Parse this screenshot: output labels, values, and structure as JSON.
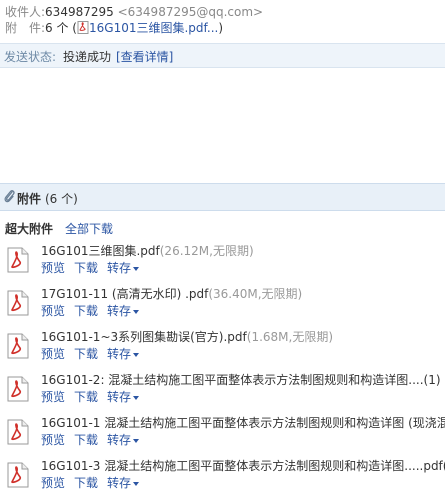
{
  "header": {
    "recipient_label": "收件人:",
    "recipient_name": "634987295",
    "recipient_email": "<634987295@qq.com>",
    "attachment_label": "附　件:",
    "attachment_count": "6 个 (",
    "attachment_first": "16G101三维图集.pdf...",
    "attachment_close": ")"
  },
  "status": {
    "label": "发送状态:",
    "value": "投递成功",
    "detail_link": "[查看详情]"
  },
  "attachments_section": {
    "title": "附件",
    "count": "(6 个)",
    "big_attach_title": "超大附件",
    "download_all": "全部下载"
  },
  "actions": {
    "preview": "预览",
    "download": "下载",
    "forward": "转存"
  },
  "files": [
    {
      "name": "16G101三维图集.pdf",
      "meta": "(26.12M,无限期)"
    },
    {
      "name": "17G101-11 (高清无水印) .pdf",
      "meta": "(36.40M,无限期)"
    },
    {
      "name": "16G101-1~3系列图集勘误(官方).pdf",
      "meta": "(1.68M,无限期)"
    },
    {
      "name": "16G101-2: 混凝土结构施工图平面整体表示方法制图规则和构造详图....(1)",
      "meta": ""
    },
    {
      "name": "16G101-1 混凝土结构施工图平面整体表示方法制图规则和构造详图 (现浇混",
      "meta": ""
    },
    {
      "name": "16G101-3 混凝土结构施工图平面整体表示方法制图规则和构造详图.....pdf(",
      "meta": ""
    }
  ],
  "colors": {
    "link": "#2b55a3",
    "status_bar_bg": "#eef4fa",
    "attach_header_bg": "#e8f0f8",
    "pdf_red": "#d0302a"
  }
}
